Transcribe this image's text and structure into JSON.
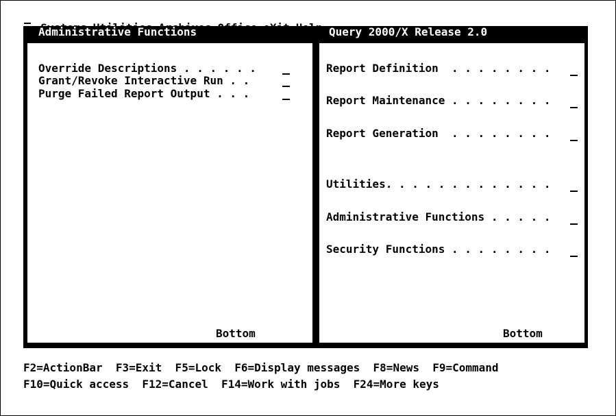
{
  "action_bar": {
    "items": [
      "Systems",
      "Utilities",
      "Archives",
      "Office",
      "eXit",
      "Help"
    ]
  },
  "left_panel": {
    "title": "Administrative Functions",
    "items": [
      {
        "label": "Override Descriptions . . . . . ."
      },
      {
        "label": "Grant/Revoke Interactive Run . ."
      },
      {
        "label": "Purge Failed Report Output . . ."
      }
    ],
    "bottom_label": "Bottom"
  },
  "right_panel": {
    "title": "Query 2000/X Release 2.0",
    "items": [
      {
        "label": "Report Definition  . . . . . . . ."
      },
      {
        "label": "Report Maintenance . . . . . . . ."
      },
      {
        "label": "Report Generation  . . . . . . . ."
      },
      {
        "label": "Utilities. . . . . . . . . . . . ."
      },
      {
        "label": "Administrative Functions . . . . ."
      },
      {
        "label": "Security Functions . . . . . . . ."
      }
    ],
    "bottom_label": "Bottom"
  },
  "function_keys": {
    "line1": "F2=ActionBar  F3=Exit  F5=Lock  F6=Display messages  F8=News  F9=Command",
    "line2": "F10=Quick access  F12=Cancel  F14=Work with jobs  F24=More keys"
  }
}
